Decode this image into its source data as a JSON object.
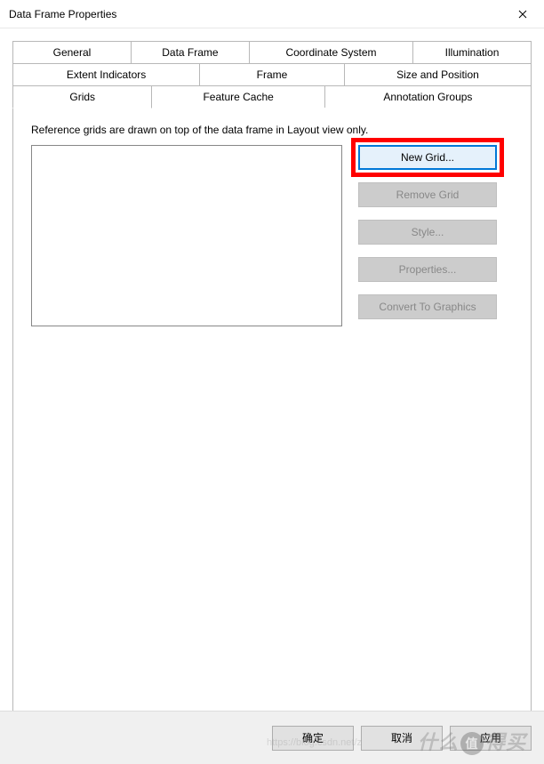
{
  "window": {
    "title": "Data Frame Properties"
  },
  "tabs": {
    "row1": [
      {
        "label": "General"
      },
      {
        "label": "Data Frame"
      },
      {
        "label": "Coordinate System"
      },
      {
        "label": "Illumination"
      }
    ],
    "row2": [
      {
        "label": "Extent Indicators"
      },
      {
        "label": "Frame"
      },
      {
        "label": "Size and Position"
      }
    ],
    "row3": [
      {
        "label": "Grids"
      },
      {
        "label": "Feature Cache"
      },
      {
        "label": "Annotation Groups"
      }
    ]
  },
  "panel": {
    "description": "Reference grids are drawn on top of the data frame in Layout view only."
  },
  "buttons": {
    "new_grid": "New Grid...",
    "remove_grid": "Remove Grid",
    "style": "Style...",
    "properties": "Properties...",
    "convert": "Convert To Graphics"
  },
  "footer": {
    "ok": "确定",
    "cancel": "取消",
    "apply": "应用"
  },
  "watermark": {
    "text_left": "什么",
    "text_right": "得买",
    "circle": "值",
    "url": "https://blog.csdn.net/z"
  }
}
